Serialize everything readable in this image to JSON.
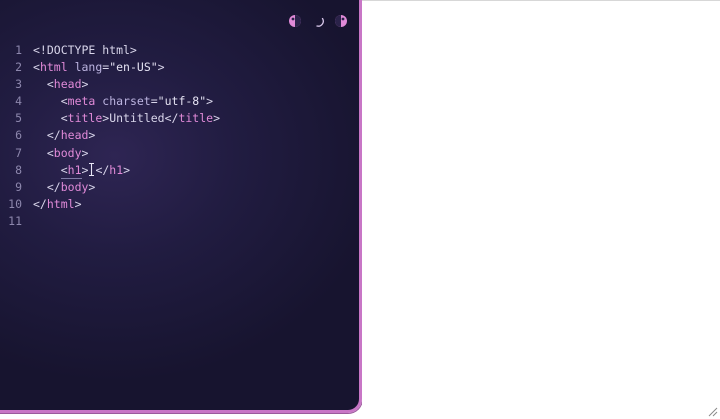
{
  "toolbar": {
    "buttons": [
      {
        "icon": "theme-toggle-icon"
      },
      {
        "icon": "loading-spinner-icon"
      },
      {
        "icon": "contrast-icon"
      }
    ]
  },
  "colors": {
    "border": "#c876c6",
    "editor_bg": "#1f1a3d",
    "tag": "#e08ad8",
    "attr": "#bcb4e0",
    "text": "#d8d5ea",
    "line_number": "#8d87ad"
  },
  "editor": {
    "lines": [
      {
        "n": "1",
        "t1": "<!DOCTYPE html>"
      },
      {
        "n": "2",
        "p1": "<",
        "tag": "html",
        "attr": " lang",
        "eq": "=",
        "str": "\"en-US\"",
        "p2": ">"
      },
      {
        "n": "3",
        "indent": "  ",
        "p1": "<",
        "tag": "head",
        "p2": ">"
      },
      {
        "n": "4",
        "indent": "    ",
        "p1": "<",
        "tag": "meta",
        "attr": " charset",
        "eq": "=",
        "str": "\"utf-8\"",
        "p2": ">"
      },
      {
        "n": "5",
        "indent": "    ",
        "p1": "<",
        "tag": "title",
        "p2": ">",
        "text": "Untitled",
        "p3": "</",
        "tag2": "title",
        "p4": ">"
      },
      {
        "n": "6",
        "indent": "  ",
        "p1": "</",
        "tag": "head",
        "p2": ">"
      },
      {
        "n": "7",
        "indent": "  ",
        "p1": "<",
        "tag": "body",
        "p2": ">"
      },
      {
        "n": "8",
        "indent": "    ",
        "p1": "<",
        "tag": "h1",
        "p2": ">",
        "p3": "</",
        "tag2": "h1",
        "p4": ">"
      },
      {
        "n": "9",
        "indent": "  ",
        "p1": "</",
        "tag": "body",
        "p2": ">"
      },
      {
        "n": "10",
        "p1": "</",
        "tag": "html",
        "p2": ">"
      },
      {
        "n": "11"
      }
    ]
  }
}
